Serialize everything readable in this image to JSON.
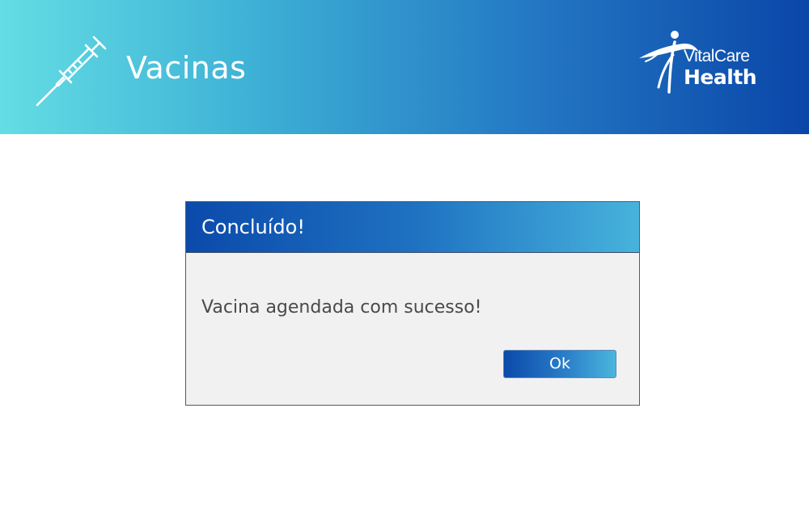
{
  "header": {
    "title": "Vacinas",
    "icon": "syringe-icon",
    "gradient": [
      "#64dde4",
      "#0a46a8"
    ]
  },
  "logo": {
    "line1": "VitalCare",
    "line2": "Health",
    "icon": "person-figure-icon"
  },
  "dialog": {
    "title": "Concluído!",
    "message": "Vacina agendada com sucesso!",
    "ok_label": "Ok",
    "header_gradient": [
      "#0b4aab",
      "#47b3dc"
    ],
    "body_color": "#f1f1f2"
  }
}
